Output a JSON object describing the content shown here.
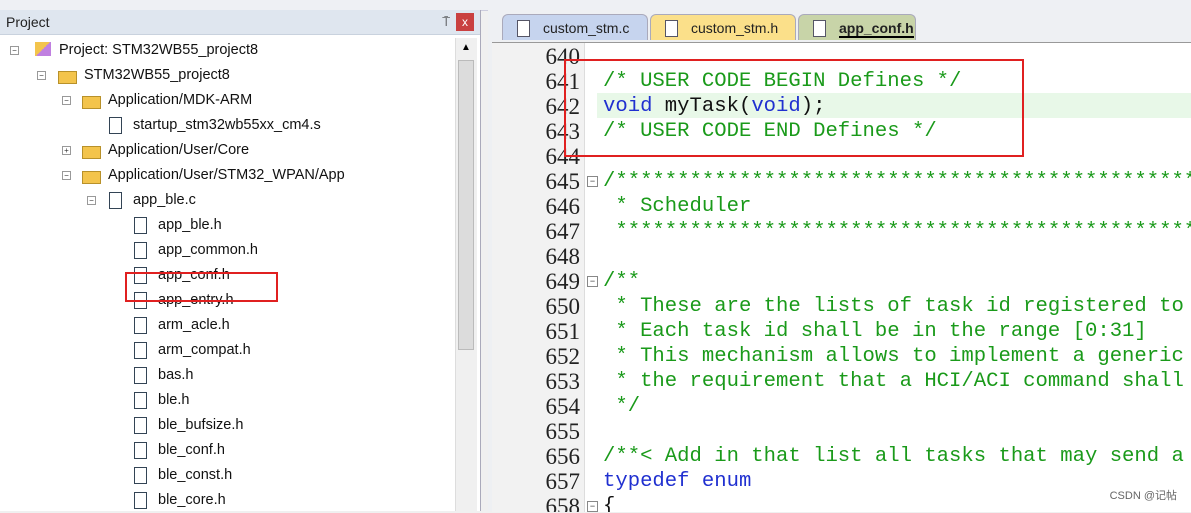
{
  "project_panel": {
    "title": "Project",
    "pin": "⍑",
    "close": "x"
  },
  "tree": [
    {
      "label": "Project: STM32WB55_project8",
      "level": 0,
      "icon": "project",
      "exp": "-"
    },
    {
      "label": "STM32WB55_project8",
      "level": 1,
      "icon": "folder",
      "exp": "-"
    },
    {
      "label": "Application/MDK-ARM",
      "level": 2,
      "icon": "folder",
      "exp": "-"
    },
    {
      "label": "startup_stm32wb55xx_cm4.s",
      "level": 3,
      "icon": "file",
      "exp": ""
    },
    {
      "label": "Application/User/Core",
      "level": 2,
      "icon": "folder",
      "exp": "+"
    },
    {
      "label": "Application/User/STM32_WPAN/App",
      "level": 2,
      "icon": "folder",
      "exp": "-"
    },
    {
      "label": "app_ble.c",
      "level": 3,
      "icon": "file",
      "exp": "-"
    },
    {
      "label": "app_ble.h",
      "level": 4,
      "icon": "file",
      "exp": ""
    },
    {
      "label": "app_common.h",
      "level": 4,
      "icon": "file",
      "exp": ""
    },
    {
      "label": "app_conf.h",
      "level": 4,
      "icon": "file",
      "exp": ""
    },
    {
      "label": "app_entry.h",
      "level": 4,
      "icon": "file",
      "exp": ""
    },
    {
      "label": "arm_acle.h",
      "level": 4,
      "icon": "file",
      "exp": ""
    },
    {
      "label": "arm_compat.h",
      "level": 4,
      "icon": "file",
      "exp": ""
    },
    {
      "label": "bas.h",
      "level": 4,
      "icon": "file",
      "exp": ""
    },
    {
      "label": "ble.h",
      "level": 4,
      "icon": "file",
      "exp": ""
    },
    {
      "label": "ble_bufsize.h",
      "level": 4,
      "icon": "file",
      "exp": ""
    },
    {
      "label": "ble_conf.h",
      "level": 4,
      "icon": "file",
      "exp": ""
    },
    {
      "label": "ble_const.h",
      "level": 4,
      "icon": "file",
      "exp": ""
    },
    {
      "label": "ble_core.h",
      "level": 4,
      "icon": "file",
      "exp": ""
    }
  ],
  "tabs": [
    {
      "label": "custom_stm.c",
      "color": "#c6d4ee"
    },
    {
      "label": "custom_stm.h",
      "color": "#fbe08a"
    },
    {
      "label": "app_conf.h",
      "color": "#c8d4a8",
      "active": true
    }
  ],
  "code": [
    {
      "n": "640",
      "fold": "",
      "parts": []
    },
    {
      "n": "641",
      "fold": "",
      "parts": [
        {
          "t": "/* USER CODE BEGIN Defines */",
          "c": "cm"
        }
      ]
    },
    {
      "n": "642",
      "fold": "",
      "parts": [
        {
          "t": "void",
          "c": "kw"
        },
        {
          "t": " myTask(",
          "c": "pl"
        },
        {
          "t": "void",
          "c": "kw"
        },
        {
          "t": ");",
          "c": "pl"
        }
      ]
    },
    {
      "n": "643",
      "fold": "",
      "parts": [
        {
          "t": "/* USER CODE END Defines */",
          "c": "cm"
        }
      ]
    },
    {
      "n": "644",
      "fold": "",
      "parts": []
    },
    {
      "n": "645",
      "fold": "-",
      "parts": [
        {
          "t": "/*****************************************************",
          "c": "cm"
        }
      ]
    },
    {
      "n": "646",
      "fold": "",
      "parts": [
        {
          "t": " * Scheduler",
          "c": "cm"
        }
      ]
    },
    {
      "n": "647",
      "fold": "",
      "parts": [
        {
          "t": " *****************************************************",
          "c": "cm"
        }
      ]
    },
    {
      "n": "648",
      "fold": "",
      "parts": []
    },
    {
      "n": "649",
      "fold": "-",
      "parts": [
        {
          "t": "/**",
          "c": "cm"
        }
      ]
    },
    {
      "n": "650",
      "fold": "",
      "parts": [
        {
          "t": " * These are the lists of task id registered to",
          "c": "cm"
        }
      ]
    },
    {
      "n": "651",
      "fold": "",
      "parts": [
        {
          "t": " * Each task id shall be in the range [0:31]",
          "c": "cm"
        }
      ]
    },
    {
      "n": "652",
      "fold": "",
      "parts": [
        {
          "t": " * This mechanism allows to implement a generic",
          "c": "cm"
        }
      ]
    },
    {
      "n": "653",
      "fold": "",
      "parts": [
        {
          "t": " * the requirement that a HCI/ACI command shall",
          "c": "cm"
        }
      ]
    },
    {
      "n": "654",
      "fold": "",
      "parts": [
        {
          "t": " */",
          "c": "cm"
        }
      ]
    },
    {
      "n": "655",
      "fold": "",
      "parts": []
    },
    {
      "n": "656",
      "fold": "",
      "parts": [
        {
          "t": "/**< Add in that list all tasks that may send a",
          "c": "cm"
        }
      ]
    },
    {
      "n": "657",
      "fold": "",
      "parts": [
        {
          "t": "typedef",
          "c": "kw"
        },
        {
          "t": " ",
          "c": "pl"
        },
        {
          "t": "enum",
          "c": "kw"
        }
      ]
    },
    {
      "n": "658",
      "fold": "-",
      "parts": [
        {
          "t": "{",
          "c": "pl"
        }
      ]
    }
  ],
  "watermark": "CSDN @记帖"
}
